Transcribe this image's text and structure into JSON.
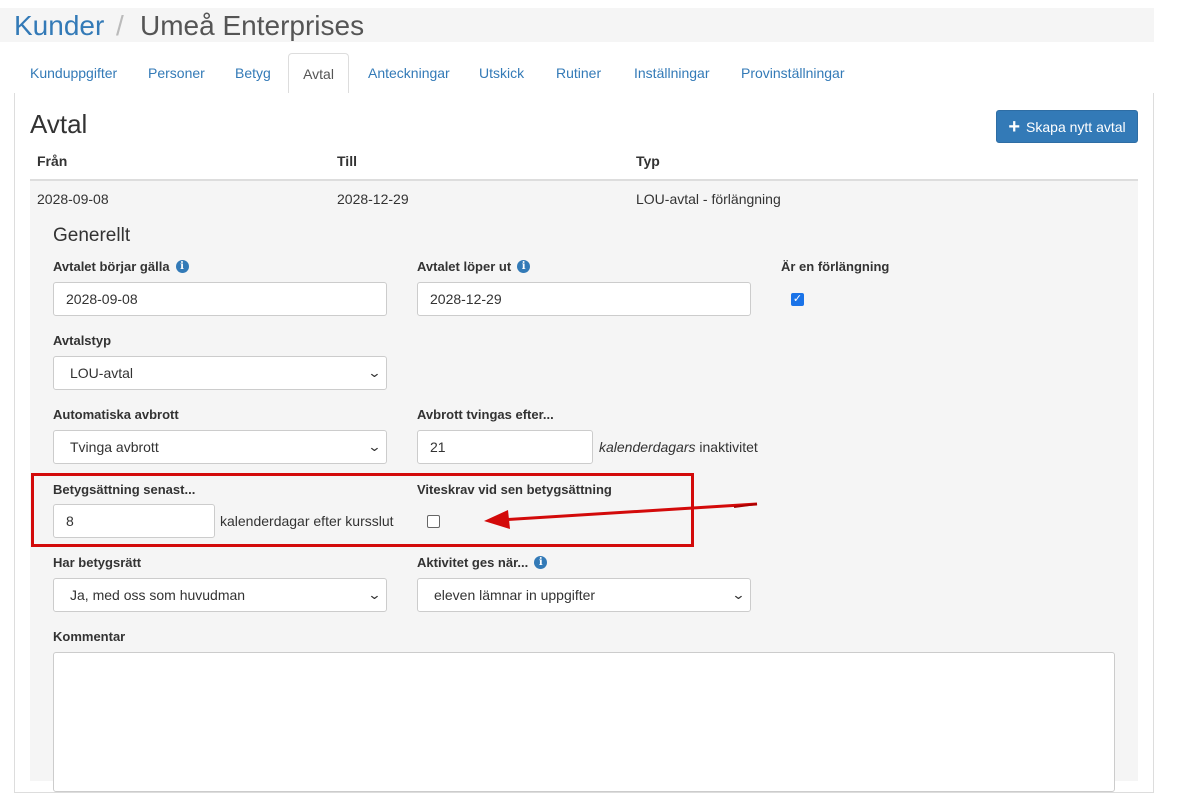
{
  "breadcrumb": {
    "parent": "Kunder",
    "separator": "/",
    "current": "Umeå Enterprises"
  },
  "tabs": [
    {
      "label": "Kunduppgifter"
    },
    {
      "label": "Personer"
    },
    {
      "label": "Betyg"
    },
    {
      "label": "Avtal"
    },
    {
      "label": "Anteckningar"
    },
    {
      "label": "Utskick"
    },
    {
      "label": "Rutiner"
    },
    {
      "label": "Inställningar"
    },
    {
      "label": "Provinställningar"
    }
  ],
  "page": {
    "title": "Avtal",
    "create_button": "Skapa nytt avtal"
  },
  "table": {
    "headers": [
      "Från",
      "Till",
      "Typ"
    ],
    "row": {
      "from": "2028-09-08",
      "to": "2028-12-29",
      "type": "LOU-avtal - förlängning"
    }
  },
  "form": {
    "section": "Generellt",
    "start_label": "Avtalet börjar gälla",
    "start_value": "2028-09-08",
    "end_label": "Avtalet löper ut",
    "end_value": "2028-12-29",
    "extension_label": "Är en förlängning",
    "extension_checked": true,
    "type_label": "Avtalstyp",
    "type_value": "LOU-avtal",
    "auto_break_label": "Automatiska avbrott",
    "auto_break_value": "Tvinga avbrott",
    "force_break_label": "Avbrott tvingas efter...",
    "force_break_value": "21",
    "force_break_suffix_italic": "kalenderdagars",
    "force_break_suffix": "inaktivitet",
    "grading_label": "Betygsättning senast...",
    "grading_value": "8",
    "grading_suffix": "kalenderdagar efter kursslut",
    "penalty_label": "Viteskrav vid sen betygsättning",
    "penalty_checked": false,
    "grading_right_label": "Har betygsrätt",
    "grading_right_value": "Ja, med oss som huvudman",
    "activity_label": "Aktivitet ges när...",
    "activity_value": "eleven lämnar in uppgifter",
    "comment_label": "Kommentar"
  },
  "icons": {
    "info": "info-circle-icon",
    "plus": "plus-icon",
    "chevron": "chevron-down-icon",
    "arrow": "red-arrow-annotation"
  },
  "colors": {
    "link": "#337ab7",
    "primary": "#337ab7",
    "highlight": "#d30a0a",
    "row_bg": "#f5f5f5"
  }
}
